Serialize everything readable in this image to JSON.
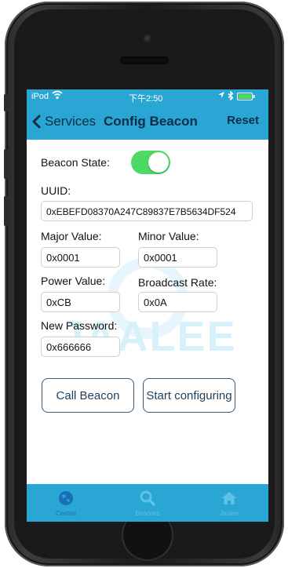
{
  "status_bar": {
    "carrier": "iPod",
    "time": "下午2:50"
  },
  "nav": {
    "back_label": "Services",
    "title": "Config Beacon",
    "reset_label": "Reset"
  },
  "form": {
    "beacon_state_label": "Beacon State:",
    "beacon_state_on": true,
    "uuid_label": "UUID:",
    "uuid_value": "0xEBEFD08370A247C89837E7B5634DF524",
    "major_label": "Major Value:",
    "major_value": "0x0001",
    "minor_label": "Minor Value:",
    "minor_value": "0x0001",
    "power_label": "Power Value:",
    "power_value": "0xCB",
    "rate_label": "Broadcast Rate:",
    "rate_value": "0x0A",
    "password_label": "New Password:",
    "password_value": "0x666666"
  },
  "buttons": {
    "call_beacon": "Call Beacon",
    "start_configuring": "Start configuring"
  },
  "watermark": "JAALEE",
  "tabs": [
    {
      "label": "Central",
      "icon": "globe-icon"
    },
    {
      "label": "Beacons",
      "icon": "search-icon"
    },
    {
      "label": "Jaalee",
      "icon": "home-icon"
    }
  ],
  "colors": {
    "accent": "#2aa6d4",
    "toggle_on": "#4cd964",
    "nav_text": "#0c2e49"
  }
}
